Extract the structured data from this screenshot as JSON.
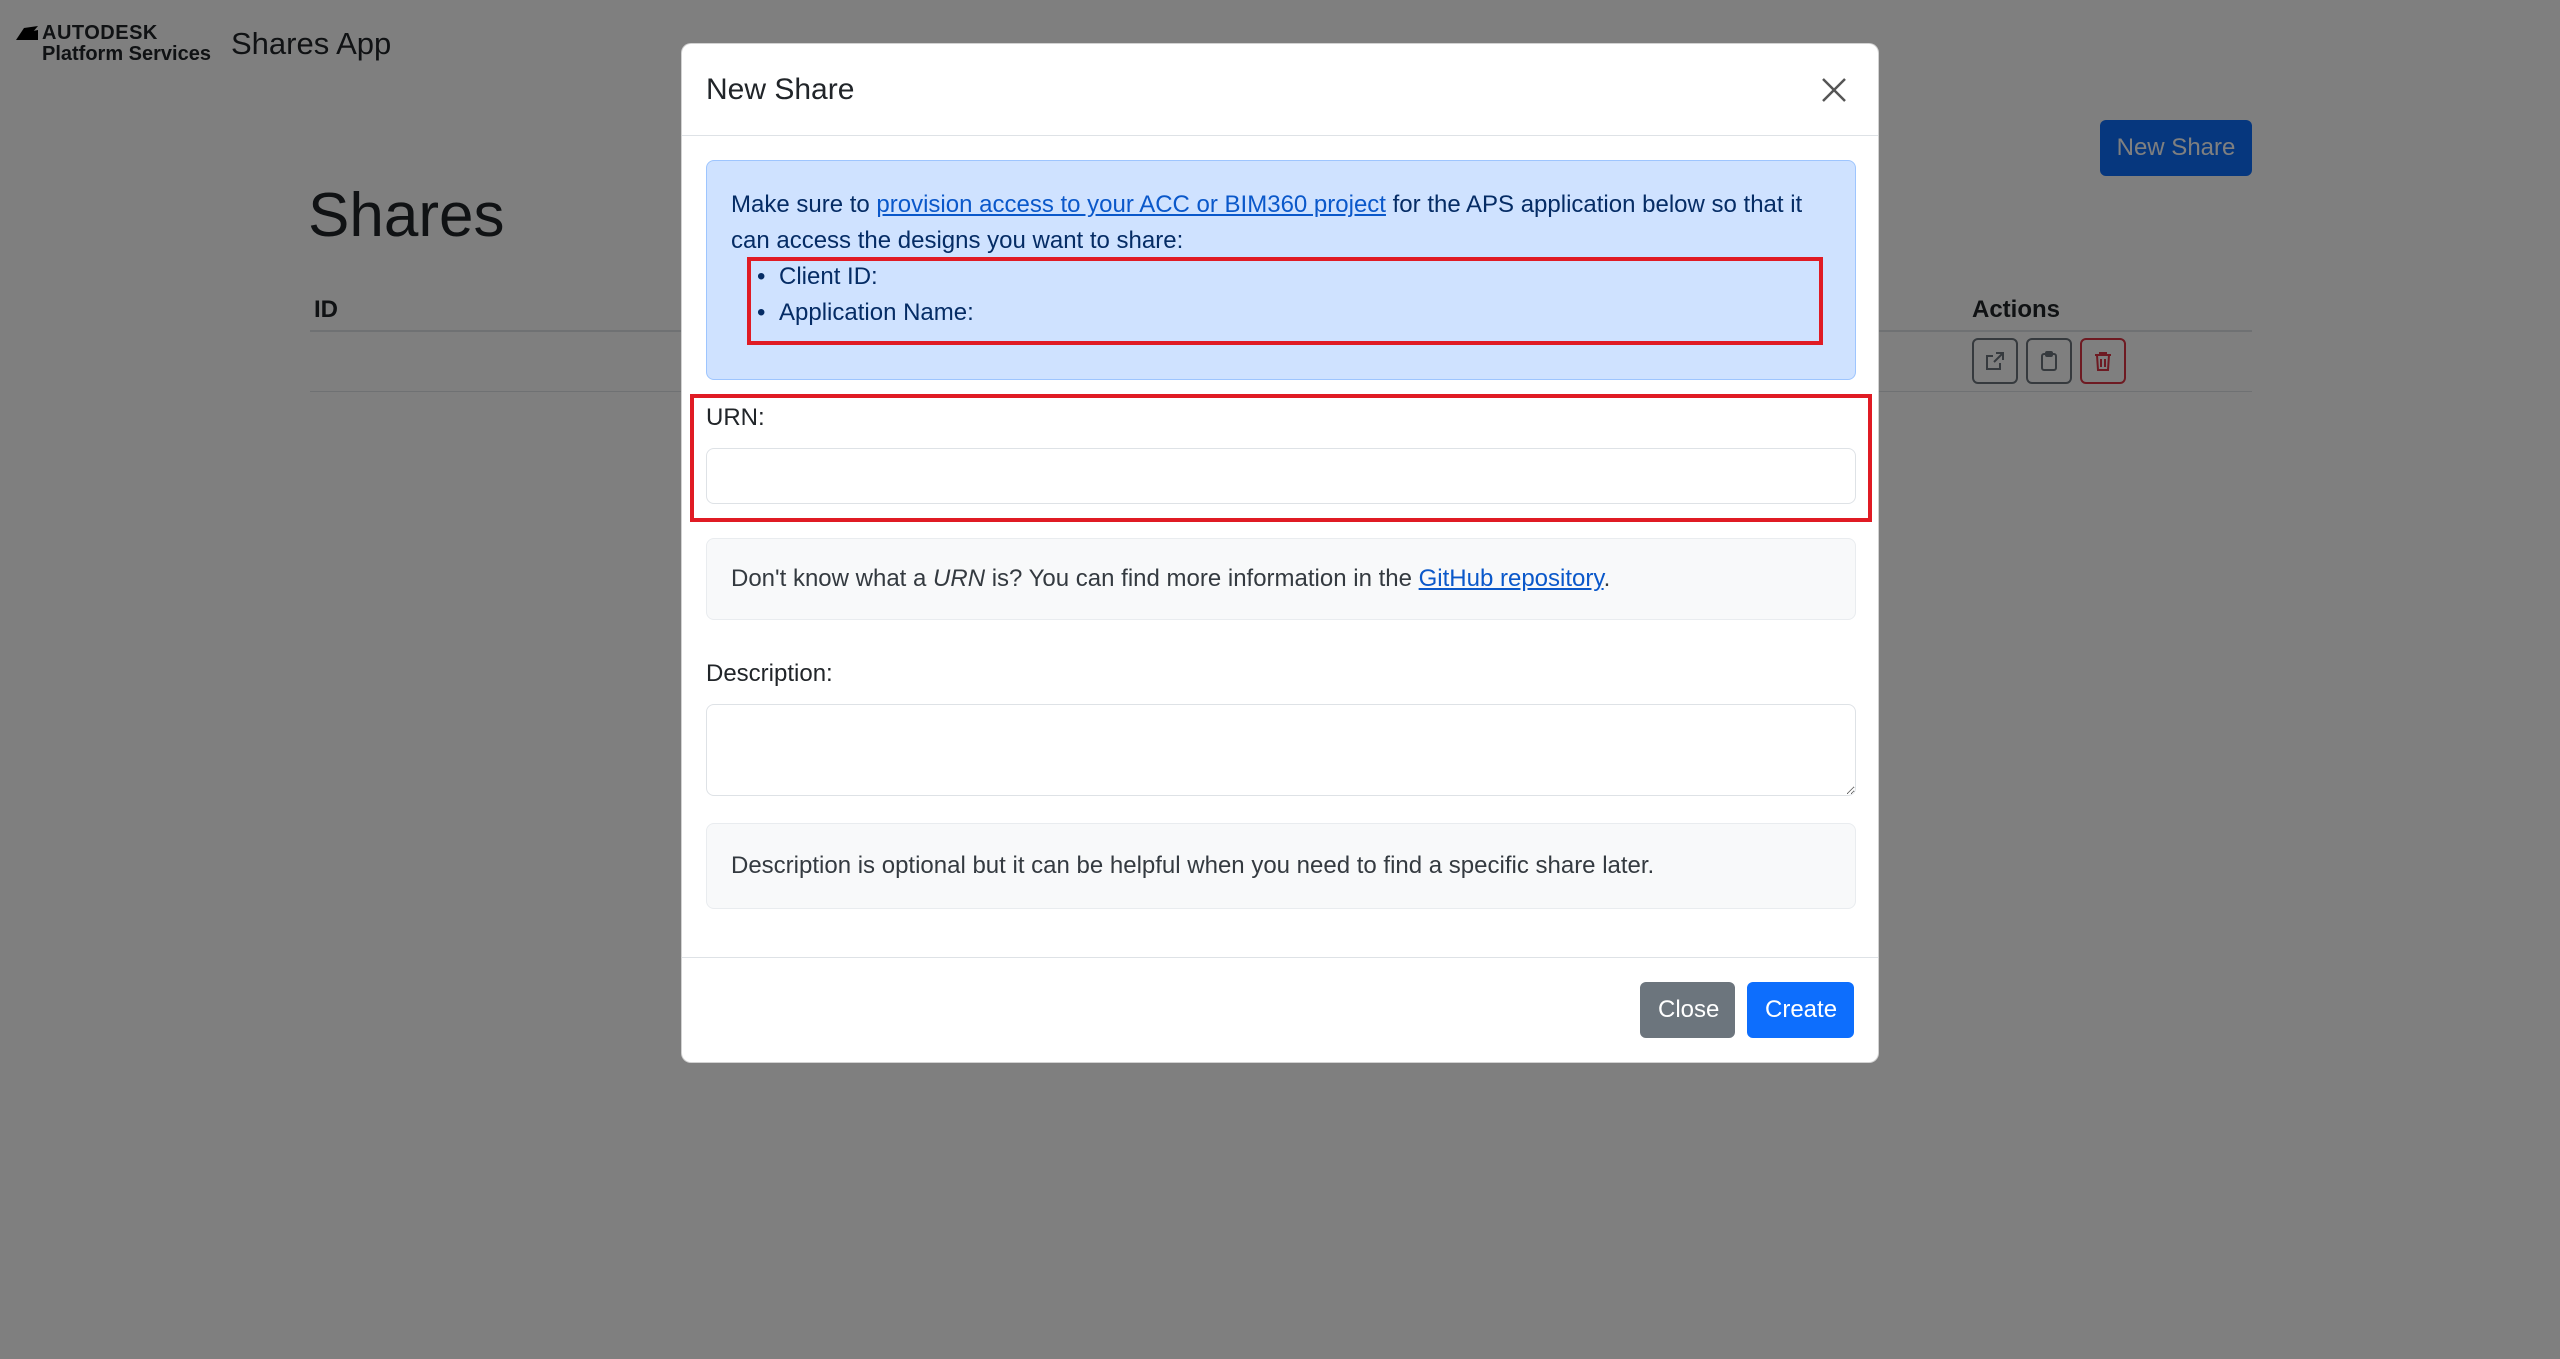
{
  "navbar": {
    "logo_top": "AUTODESK",
    "logo_bottom": "Platform Services",
    "app_title": "Shares App"
  },
  "page": {
    "heading": "Shares",
    "new_share_button": "New Share",
    "table": {
      "columns": [
        "ID",
        "Actions"
      ]
    }
  },
  "modal": {
    "title": "New Share",
    "alert": {
      "text_before": "Make sure to ",
      "link": "provision access to your ACC or BIM360 project",
      "text_after": " for the APS application below so that it can access the designs you want to share:",
      "items": [
        "Client ID:",
        "Application Name:"
      ]
    },
    "urn": {
      "label": "URN:",
      "value": "",
      "hint_before": "Don't know what a ",
      "hint_em": "URN",
      "hint_middle": " is? You can find more information in the ",
      "hint_link": "GitHub repository",
      "hint_after": "."
    },
    "description": {
      "label": "Description:",
      "value": "",
      "hint": "Description is optional but it can be helpful when you need to find a specific share later."
    },
    "footer": {
      "close_label": "Close",
      "create_label": "Create"
    }
  },
  "colors": {
    "primary": "#0d6efd",
    "secondary": "#6c757d",
    "danger": "#dc3545",
    "highlight": "#e01b24",
    "alert_bg": "#cfe2ff"
  }
}
